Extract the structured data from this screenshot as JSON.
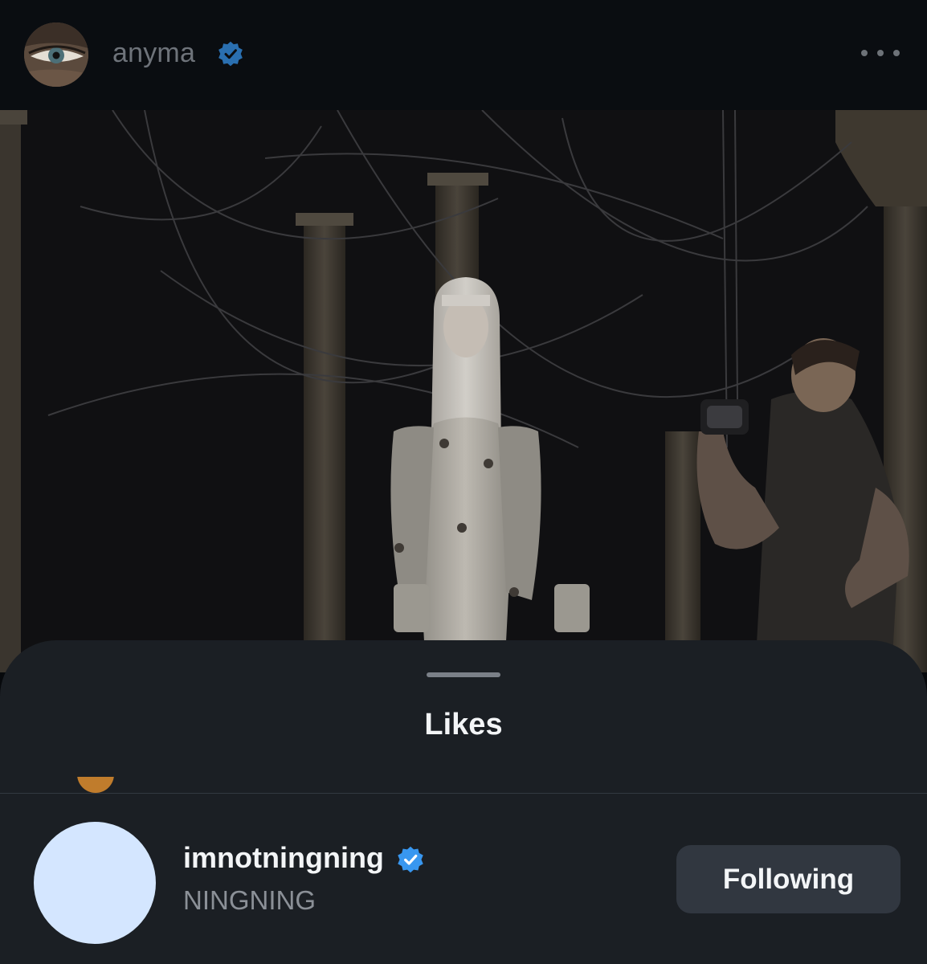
{
  "post": {
    "author": {
      "username": "anyma",
      "verified": true,
      "avatar_icon": "eye-closeup-avatar"
    },
    "more_icon": "ellipsis-icon",
    "media": {
      "kind": "photo",
      "icon": "photo-scene"
    }
  },
  "likes_sheet": {
    "title": "Likes",
    "users": [
      {
        "username": "imnotningning",
        "full_name": "NINGNING",
        "verified": true,
        "action_label": "Following"
      }
    ]
  },
  "colors": {
    "verified_badge": "#3897f0",
    "sheet_background": "#1b1f24",
    "button_background": "#313740",
    "avatar_placeholder": "#d4e6ff"
  }
}
